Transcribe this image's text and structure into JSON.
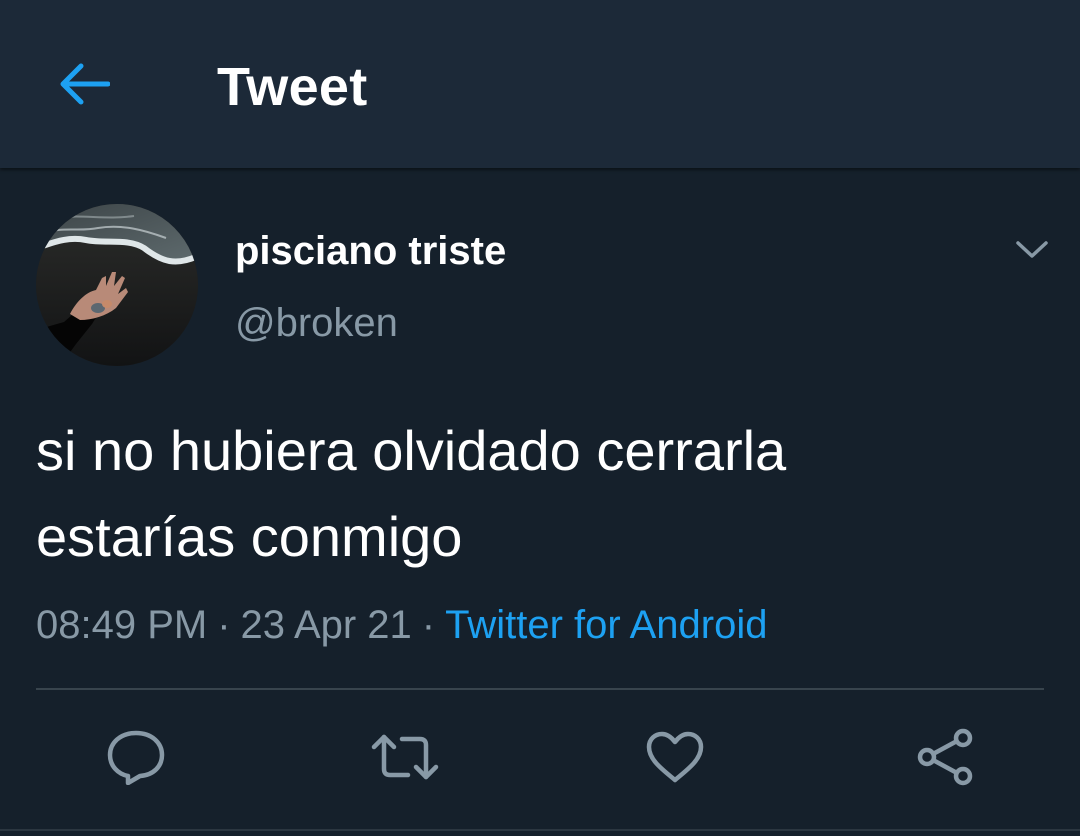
{
  "header": {
    "title": "Tweet",
    "back_icon": "arrow-left-icon"
  },
  "author": {
    "display_name": "pisciano triste",
    "handle": "@broken",
    "avatar": "avatar-photo",
    "menu_icon": "chevron-down-icon"
  },
  "tweet": {
    "text_lines": [
      "si no hubiera olvidado cerrarla",
      "estarías conmigo"
    ],
    "time": "08:49 PM",
    "separator": "·",
    "date": "23 Apr 21",
    "source": "Twitter for Android"
  },
  "actions": [
    {
      "name": "reply",
      "icon": "reply-icon"
    },
    {
      "name": "retweet",
      "icon": "retweet-icon"
    },
    {
      "name": "like",
      "icon": "heart-icon"
    },
    {
      "name": "share",
      "icon": "share-icon"
    }
  ],
  "colors": {
    "background": "#15202b",
    "header_background": "#1c2938",
    "accent": "#1da1f2",
    "secondary_text": "#8899a6",
    "divider": "#38444d",
    "icon": "#8899a6"
  }
}
